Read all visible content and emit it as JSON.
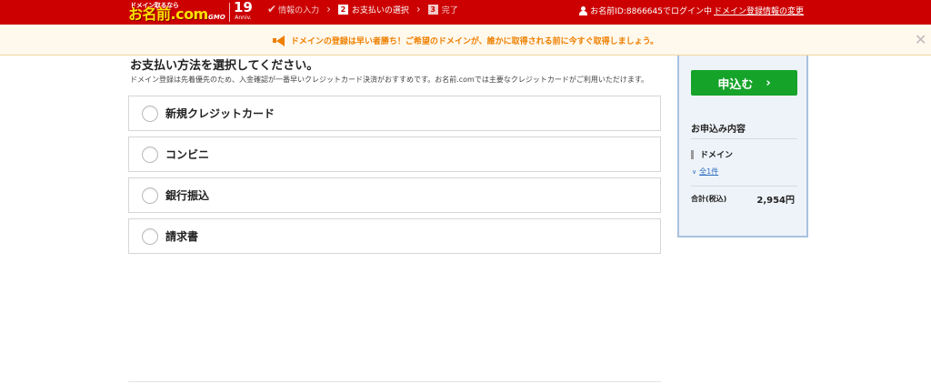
{
  "header": {
    "logo_tag": "ドメイン取るなら",
    "logo_main": "お名前.com",
    "logo_gmo": "GMO",
    "anniv_number": "19",
    "anniv_label": "Anniv.",
    "steps": [
      {
        "label": "情報の入力",
        "state": "done"
      },
      {
        "num": "2",
        "label": "お支払いの選択",
        "state": "active"
      },
      {
        "num": "3",
        "label": "完了",
        "state": "inactive"
      }
    ],
    "login_text": "お名前ID:8866645でログイン中",
    "login_link": "ドメイン登録情報の変更"
  },
  "notice": {
    "text": "ドメインの登録は早い者勝ち！ご希望のドメインが、誰かに取得される前に今すぐ取得しましょう。",
    "icon": "megaphone-icon"
  },
  "main": {
    "title": "お支払い方法を選択してください。",
    "description": "ドメイン登録は先着優先のため、入金確認が一番早いクレジットカード決済がおすすめです。お名前.comでは主要なクレジットカードがご利用いただけます。",
    "options": [
      {
        "label": "新規クレジットカード"
      },
      {
        "label": "コンビニ"
      },
      {
        "label": "銀行振込"
      },
      {
        "label": "請求書"
      }
    ]
  },
  "sidebar": {
    "apply_button": "申込む",
    "heading": "お申込み内容",
    "domain_label": "ドメイン",
    "count_link": "全1件",
    "total_label": "合計(税込)",
    "total_value": "2,954円"
  },
  "colors": {
    "header_bg": "#cc0000",
    "logo_yellow": "#ffe100",
    "notice_orange": "#ee7f00",
    "apply_green": "#16a32a",
    "sidebar_border": "#a9c2e0"
  }
}
